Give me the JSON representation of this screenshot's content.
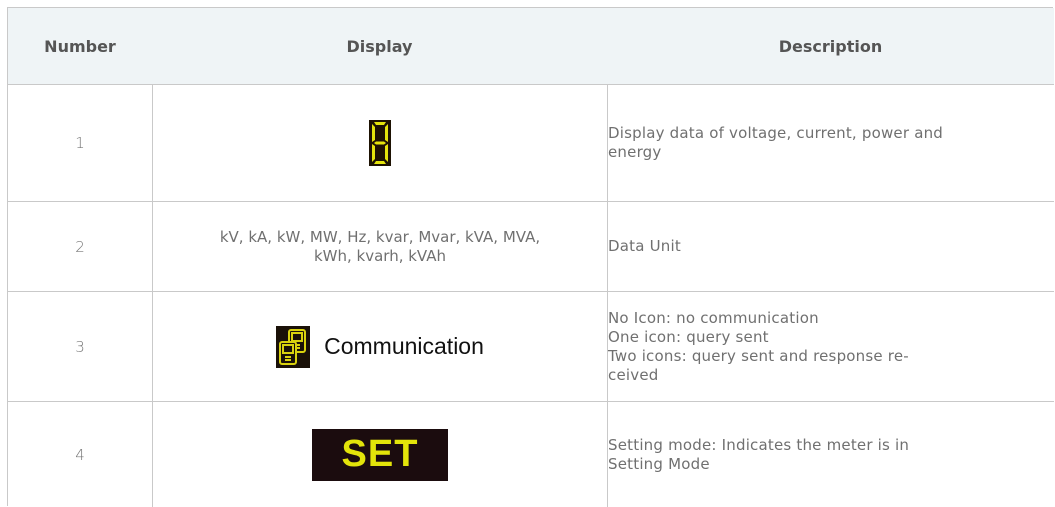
{
  "table": {
    "headers": {
      "number": "Number",
      "display": "Display",
      "description": "Description"
    },
    "rows": [
      {
        "number": "1",
        "display_icon": "seven-segment-digit-icon",
        "description": [
          "Display data of voltage, current, power and",
          "energy"
        ]
      },
      {
        "number": "2",
        "display_text": [
          "kV, kA, kW, MW, Hz, kvar, Mvar, kVA, MVA,",
          "kWh, kvarh, kVAh"
        ],
        "description": [
          "Data Unit"
        ]
      },
      {
        "number": "3",
        "display_icon": "communication-icon",
        "display_label": "Communication",
        "description": [
          "No Icon: no communication",
          "One icon: query sent",
          "Two icons: query sent and response re-",
          "ceived"
        ]
      },
      {
        "number": "4",
        "display_label": "SET",
        "description": [
          "Setting mode: Indicates the meter is in",
          "Setting Mode"
        ]
      }
    ]
  },
  "colors": {
    "header_bg": "#eff4f6",
    "border": "#c9c9c9",
    "segment_on": "#e4e40c",
    "segment_bg": "#1d1203",
    "set_text": "#e3e40a",
    "set_bg": "#1b0c0e"
  }
}
